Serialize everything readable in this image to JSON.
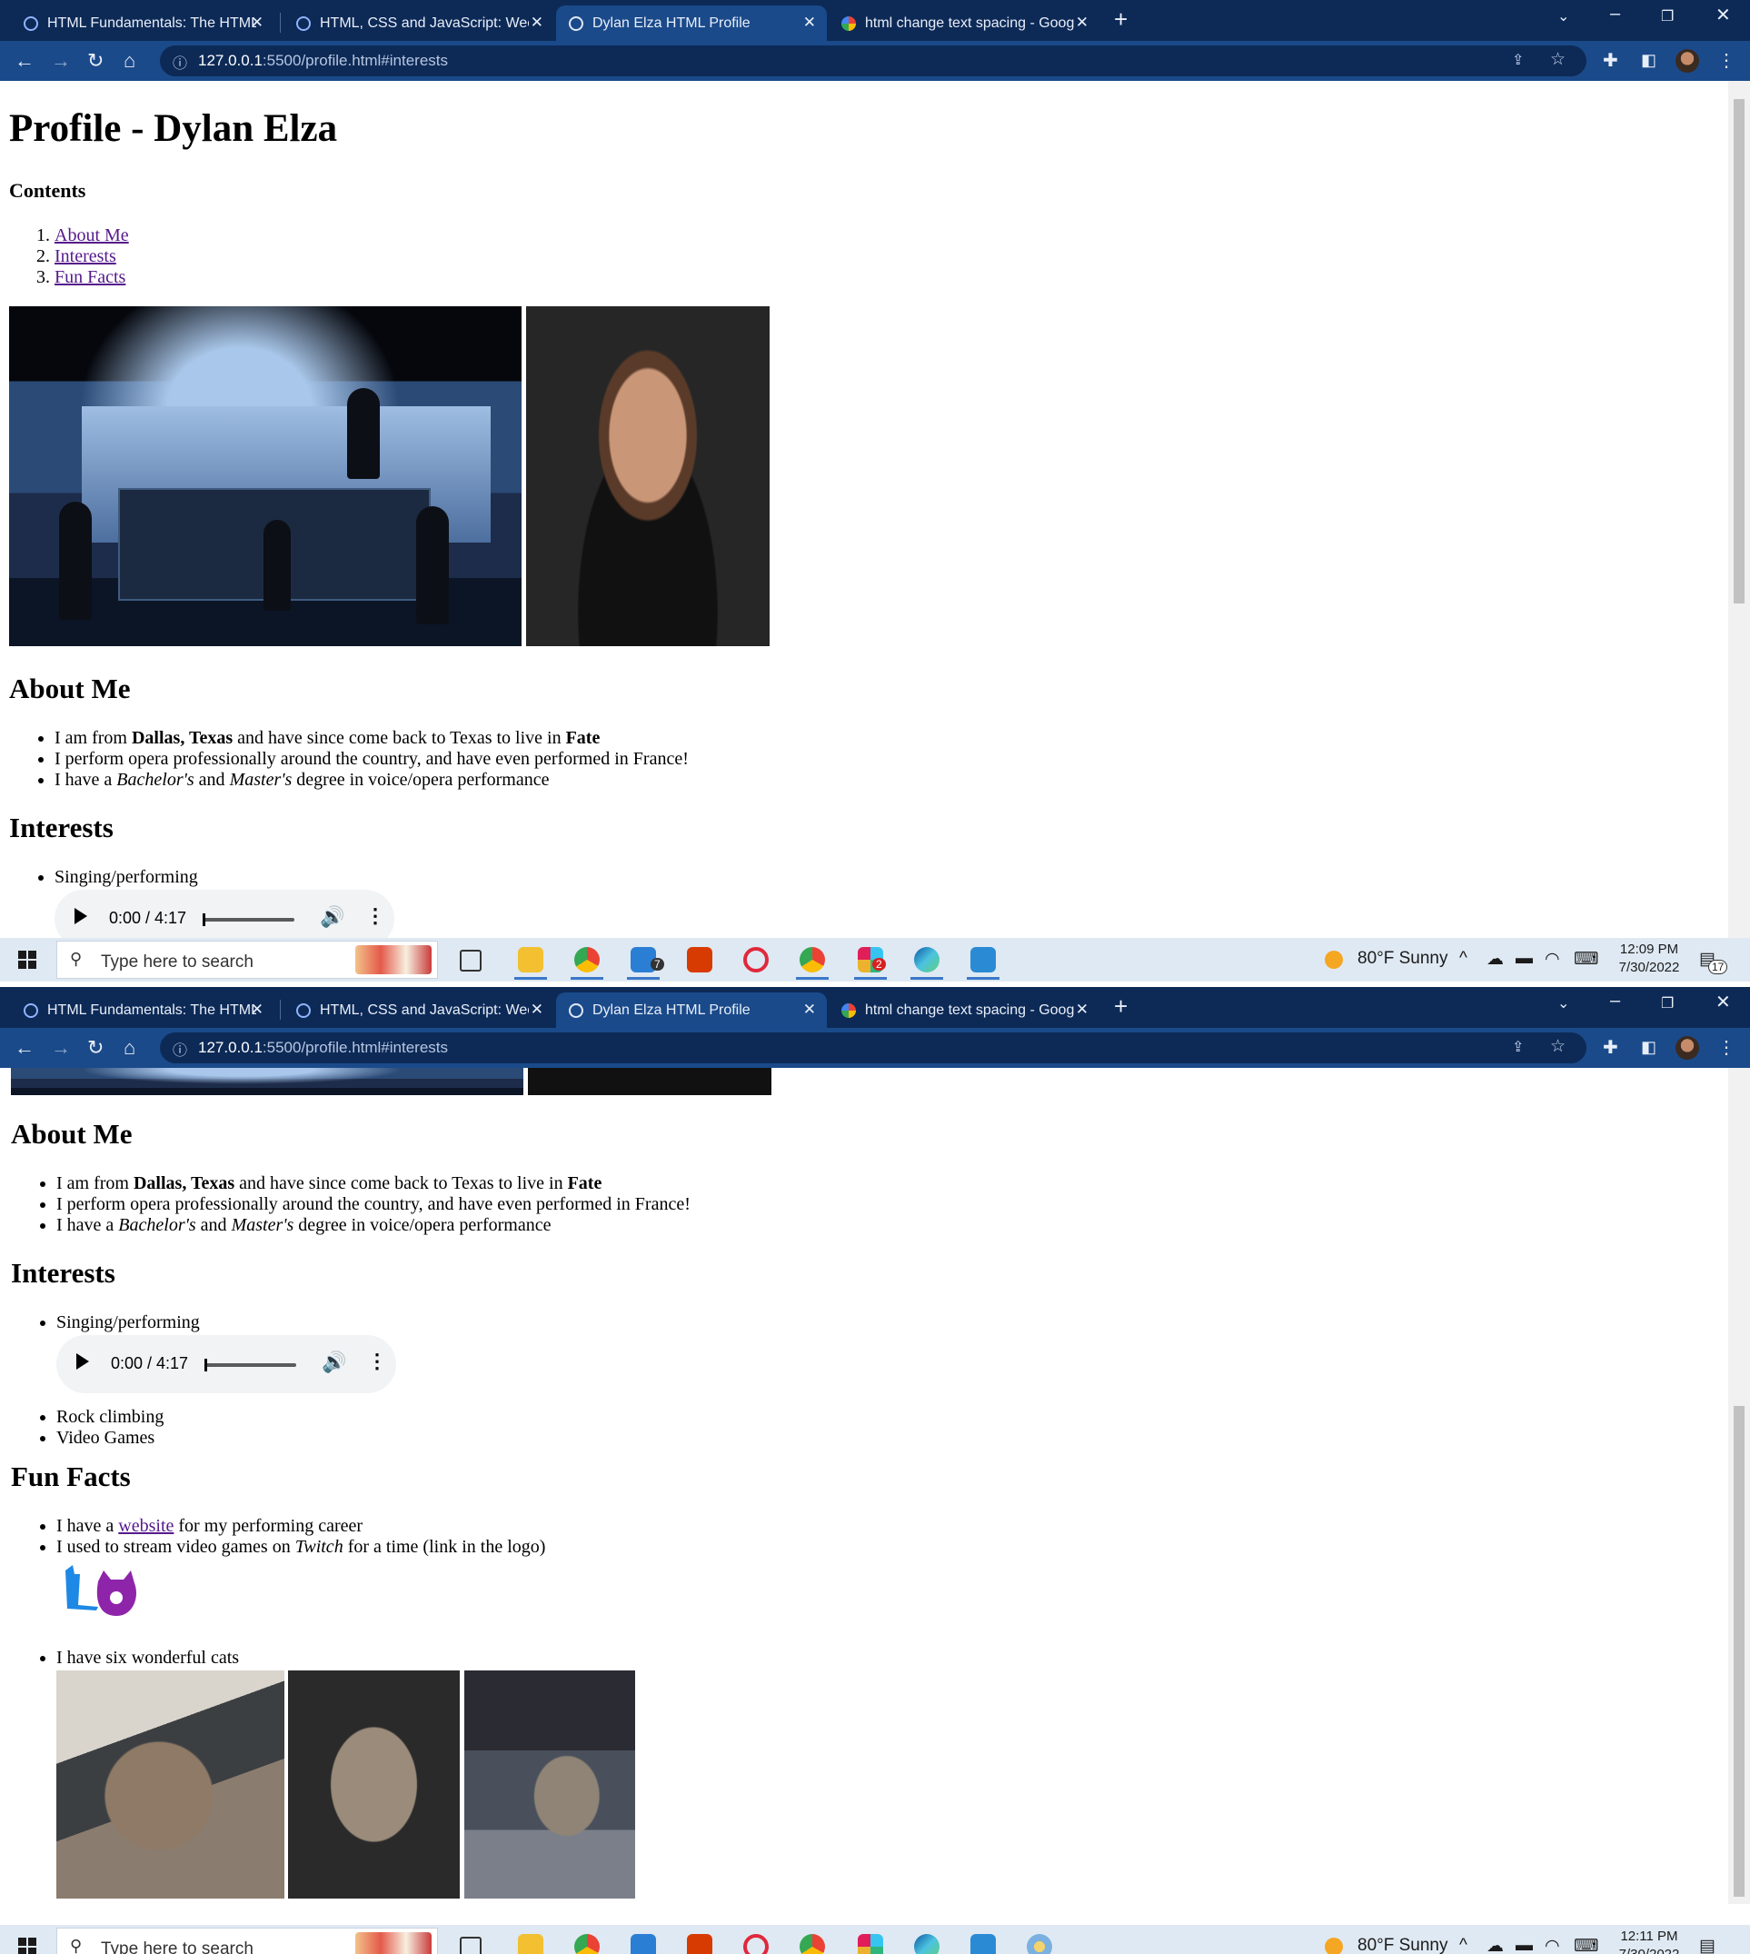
{
  "browser": {
    "tabs": [
      {
        "label": "HTML Fundamentals: The HTML E",
        "active": false,
        "icon": "codecademy-icon"
      },
      {
        "label": "HTML, CSS and JavaScript: Week",
        "active": false,
        "icon": "codecademy-icon"
      },
      {
        "label": "Dylan Elza HTML Profile",
        "active": true,
        "icon": "globe-icon"
      },
      {
        "label": "html change text spacing - Goog",
        "active": false,
        "icon": "google-icon"
      }
    ],
    "tab_close": "✕",
    "new_tab": "+",
    "url_host": "127.0.0.1",
    "url_rest": ":5500/profile.html#interests"
  },
  "page": {
    "title": "Profile - Dylan Elza",
    "contents_heading": "Contents",
    "contents": [
      "About Me",
      "Interests",
      "Fun Facts"
    ],
    "about_heading": "About Me",
    "about_items": [
      {
        "pre": "I am from ",
        "b1": "Dallas, Texas",
        "mid": " and have since come back to Texas to live in ",
        "b2": "Fate"
      },
      {
        "text": "I perform opera professionally around the country, and have even performed in France!"
      },
      {
        "pre": "I have a ",
        "i1": "Bachelor's",
        "mid": " and ",
        "i2": "Master's",
        "post": " degree in voice/opera performance"
      }
    ],
    "interests_heading": "Interests",
    "interests": [
      "Singing/performing",
      "Rock climbing",
      "Video Games"
    ],
    "audio_time": "0:00 / 4:17",
    "funfacts_heading": "Fun Facts",
    "fact1": {
      "pre": "I have a ",
      "link": "website",
      "post": " for my performing career"
    },
    "fact2": {
      "pre": "I used to stream video games on ",
      "em": "Twitch",
      "post": " for a time (link in the logo)"
    },
    "fact3": "I have six wonderful cats"
  },
  "taskbar": {
    "search_placeholder": "Type here to search",
    "weather": "80°F  Sunny",
    "mail_badge": "7",
    "slack_badge": "2",
    "notif_badge": "17",
    "shot1": {
      "time": "12:09 PM",
      "date": "7/30/2022"
    },
    "shot2": {
      "time": "12:11 PM",
      "date": "7/30/2022"
    }
  },
  "colors": {
    "tabstrip": "#0d2a57",
    "toolbar": "#1a4a8a",
    "link": "#551a8b",
    "taskbar": "#dfe9f3"
  }
}
